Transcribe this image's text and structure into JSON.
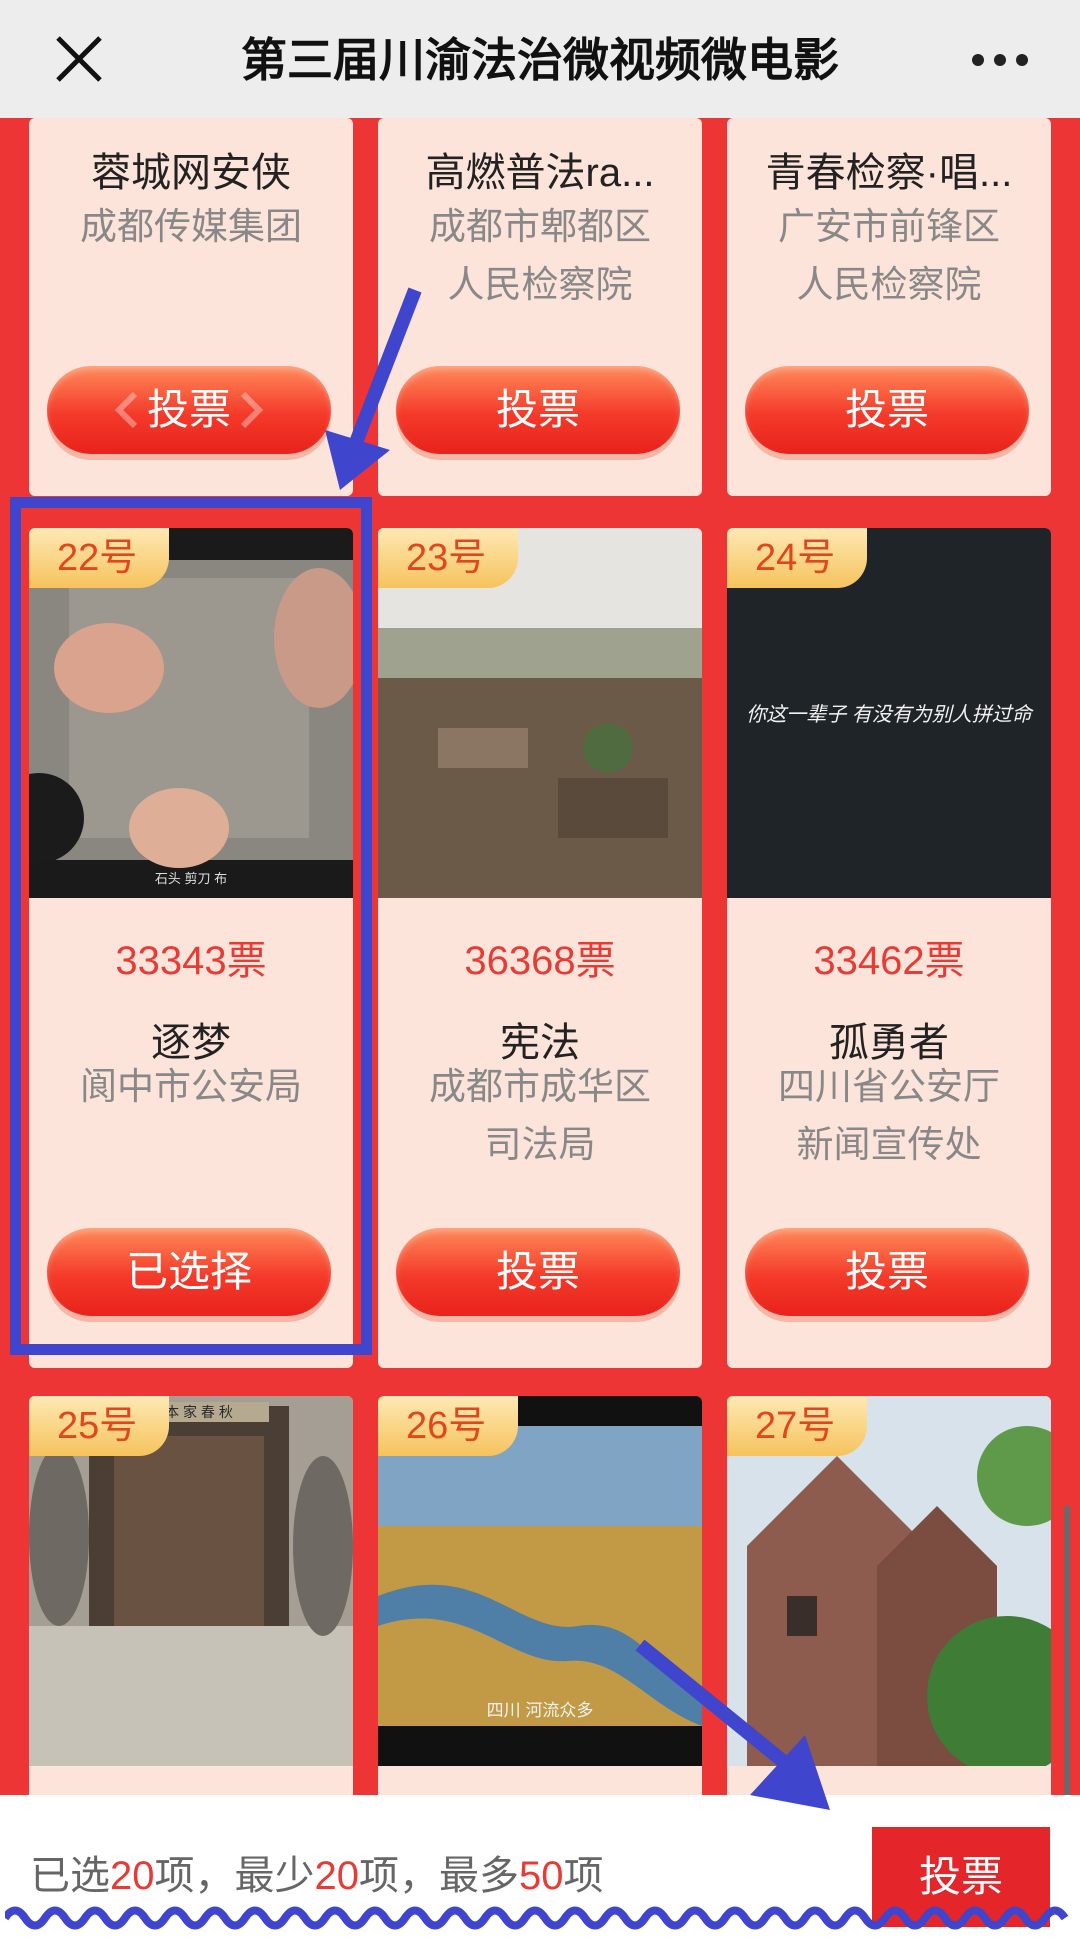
{
  "header": {
    "title": "第三届川渝法治微视频微电影",
    "close_icon": "close-icon",
    "more_icon": "more-icon"
  },
  "top_row": [
    {
      "title": "蓉城网安侠",
      "org_line1": "成都传媒集团",
      "org_line2": "",
      "button": "投票"
    },
    {
      "title": "高燃普法ra...",
      "org_line1": "成都市郫都区",
      "org_line2": "人民检察院",
      "button": "投票"
    },
    {
      "title": "青春检察·唱...",
      "org_line1": "广安市前锋区",
      "org_line2": "人民检察院",
      "button": "投票"
    }
  ],
  "mid_row": [
    {
      "badge": "22号",
      "votes": "33343票",
      "title": "逐梦",
      "org_line1": "阆中市公安局",
      "org_line2": "",
      "button": "已选择",
      "thumb_caption": "石头 剪刀 布"
    },
    {
      "badge": "23号",
      "votes": "36368票",
      "title": "宪法",
      "org_line1": "成都市成华区",
      "org_line2": "司法局",
      "button": "投票",
      "thumb_caption": ""
    },
    {
      "badge": "24号",
      "votes": "33462票",
      "title": "孤勇者",
      "org_line1": "四川省公安厅",
      "org_line2": "新闻宣传处",
      "button": "投票",
      "thumb_caption": "你这一辈子 有没有为别人拼过命"
    }
  ],
  "bottom_row": [
    {
      "badge": "25号",
      "thumb_caption": "本  家  春  秋"
    },
    {
      "badge": "26号",
      "thumb_caption": "四川 河流众多"
    },
    {
      "badge": "27号",
      "thumb_caption": ""
    }
  ],
  "footer": {
    "selected_prefix": "已选",
    "selected_count": "20",
    "min_prefix": "项，最少",
    "min_count": "20",
    "max_prefix": "项，最多",
    "max_count": "50",
    "suffix": "项",
    "vote_button": "投票"
  },
  "colors": {
    "accent_red": "#e73b36",
    "annotation_blue": "#3f45cc",
    "card_bg": "#fde4db"
  }
}
